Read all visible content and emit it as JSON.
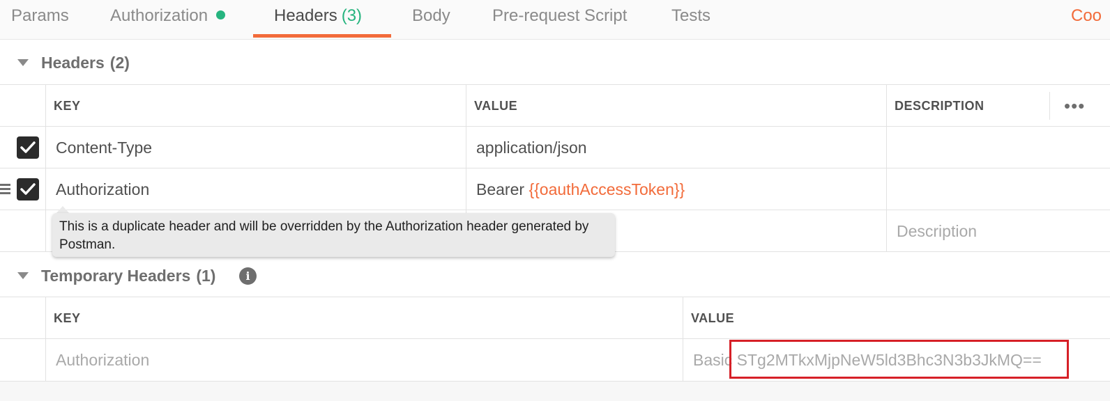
{
  "tabs": [
    {
      "label": "Params"
    },
    {
      "label": "Authorization",
      "status_dot": true
    },
    {
      "label": "Headers",
      "count": "(3)",
      "active": true
    },
    {
      "label": "Body"
    },
    {
      "label": "Pre-request Script"
    },
    {
      "label": "Tests"
    }
  ],
  "right_link": "Coo",
  "headers_section": {
    "title": "Headers",
    "count": "(2)",
    "columns": {
      "key": "KEY",
      "value": "VALUE",
      "description": "DESCRIPTION"
    },
    "more_icon": "more-horizontal-icon",
    "rows": [
      {
        "checked": true,
        "key": "Content-Type",
        "value": "application/json",
        "description": ""
      },
      {
        "checked": true,
        "key": "Authorization",
        "value_prefix": "Bearer ",
        "value_variable": "{{oauthAccessToken}}",
        "description": ""
      }
    ],
    "new_row": {
      "description_placeholder": "Description"
    }
  },
  "tooltip": {
    "text": "This is a duplicate header and will be overridden by the Authorization header generated by Postman."
  },
  "temporary_section": {
    "title": "Temporary Headers",
    "count": "(1)",
    "info_icon": "info-icon",
    "columns": {
      "key": "KEY",
      "value": "VALUE"
    },
    "rows": [
      {
        "key": "Authorization",
        "value": "Basic STg2MTkxMjpNeW5ld3Bhc3N3b3JkMQ=="
      }
    ]
  },
  "colors": {
    "accent": "#f26b3a",
    "success": "#26b47f",
    "highlight": "#d62027"
  }
}
